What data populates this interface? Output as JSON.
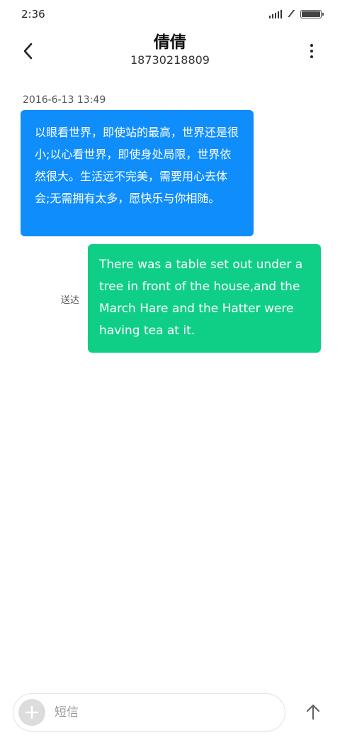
{
  "status_bar": {
    "time": "2:36",
    "battery_level": 1.0
  },
  "header": {
    "contact_name": "倩倩",
    "contact_number": "18730218809",
    "back_icon": "chevron-left-icon",
    "more_icon": "more-vertical-icon"
  },
  "thread": {
    "timestamp": "2016-6-13 13:49",
    "incoming_message": {
      "text": "以眼看世界，即使站的最高，世界还是很小;以心看世界，即使身处局限，世界依然很大。生活远不完美，需要用心去体会;无需拥有太多，愿快乐与你相随。",
      "color": "#0f8dfb"
    },
    "outgoing_message": {
      "text": "There was a table set out under a tree in front of the house,and the March Hare and the Hatter were having tea at it.",
      "status": "送达",
      "color": "#0fcf86"
    }
  },
  "composer": {
    "placeholder": "短信",
    "value": "",
    "add_icon": "plus-icon",
    "send_icon": "arrow-up-icon"
  }
}
